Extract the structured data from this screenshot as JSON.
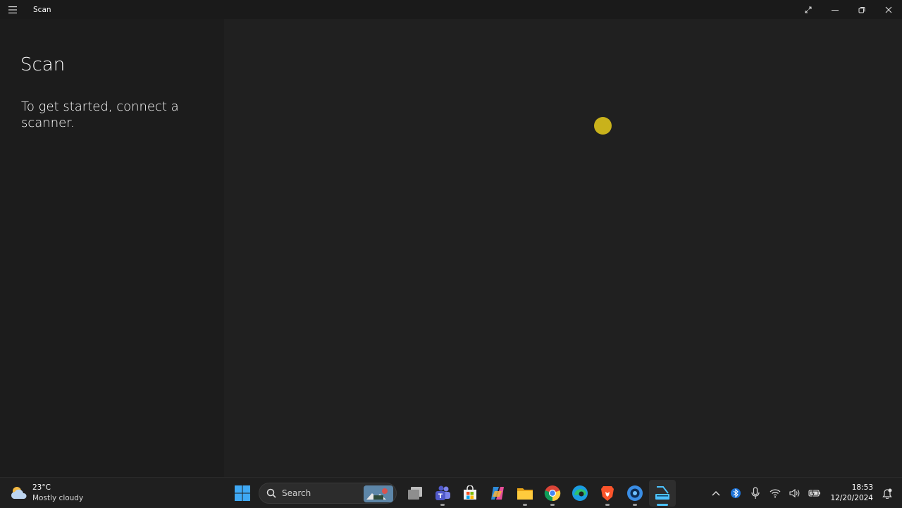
{
  "window": {
    "title": "Scan"
  },
  "sidebar": {
    "title": "Scan",
    "message": "To get started, connect a scanner."
  },
  "taskbar": {
    "weather": {
      "temperature": "23°C",
      "condition": "Mostly cloudy",
      "icon": "partly-cloudy-icon"
    },
    "search": {
      "placeholder": "Search"
    },
    "pinned": [
      "windows-start-icon",
      "search-icon",
      "task-view-icon",
      "teams-icon",
      "microsoft-store-icon",
      "copilot-icon",
      "file-explorer-icon",
      "chrome-icon",
      "edge-icon",
      "brave-icon",
      "camera-app-icon",
      "scan-app-icon"
    ],
    "tray": {
      "icons": [
        "chevron-up-icon",
        "bluetooth-icon",
        "microphone-icon",
        "wifi-icon",
        "volume-icon",
        "battery-icon",
        "notification-bell-icon"
      ],
      "time": "18:53",
      "date": "12/20/2024"
    }
  },
  "colors": {
    "background": "#202020",
    "sidebar": "#1c1c1c",
    "accent": "#4cc2ff",
    "cursor_highlight": "#c9b21b"
  }
}
